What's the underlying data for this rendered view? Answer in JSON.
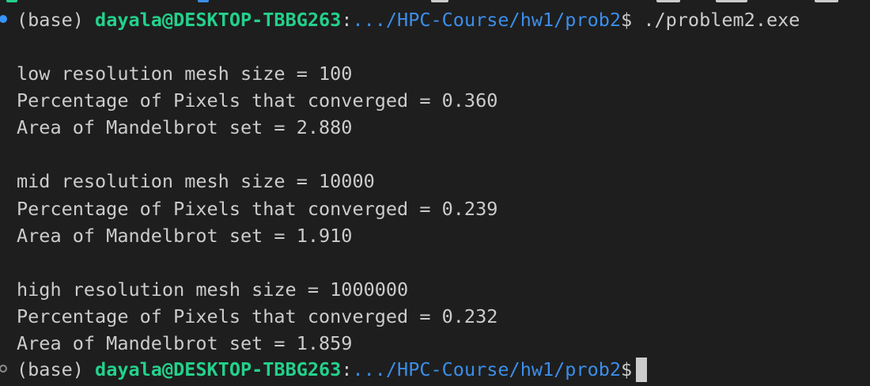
{
  "terminal": {
    "prompts": [
      {
        "env": "(base) ",
        "user_host": "dayala@DESKTOP-TBBG263",
        "separator": ":",
        "path": ".../HPC-Course/hw1/prob2",
        "symbol": "$",
        "command": " ./problem2.exe",
        "status": "completed"
      },
      {
        "env": "(base) ",
        "user_host": "dayala@DESKTOP-TBBG263",
        "separator": ":",
        "path": ".../HPC-Course/hw1/prob2",
        "symbol": "$",
        "command": "",
        "status": "active"
      }
    ],
    "output": [
      "low resolution mesh size = 100",
      "Percentage of Pixels that converged = 0.360",
      "Area of Mandelbrot set = 2.880",
      "mid resolution mesh size = 10000",
      "Percentage of Pixels that converged = 0.239",
      "Area of Mandelbrot set = 1.910",
      "high resolution mesh size = 1000000",
      "Percentage of Pixels that converged = 0.232",
      "Area of Mandelbrot set = 1.859"
    ]
  },
  "colors": {
    "background": "#1e1e1e",
    "text": "#cccccc",
    "user_host": "#23d18b",
    "path": "#3b8eea",
    "success_marker": "#3794ff",
    "idle_marker": "#8b8b8b"
  }
}
